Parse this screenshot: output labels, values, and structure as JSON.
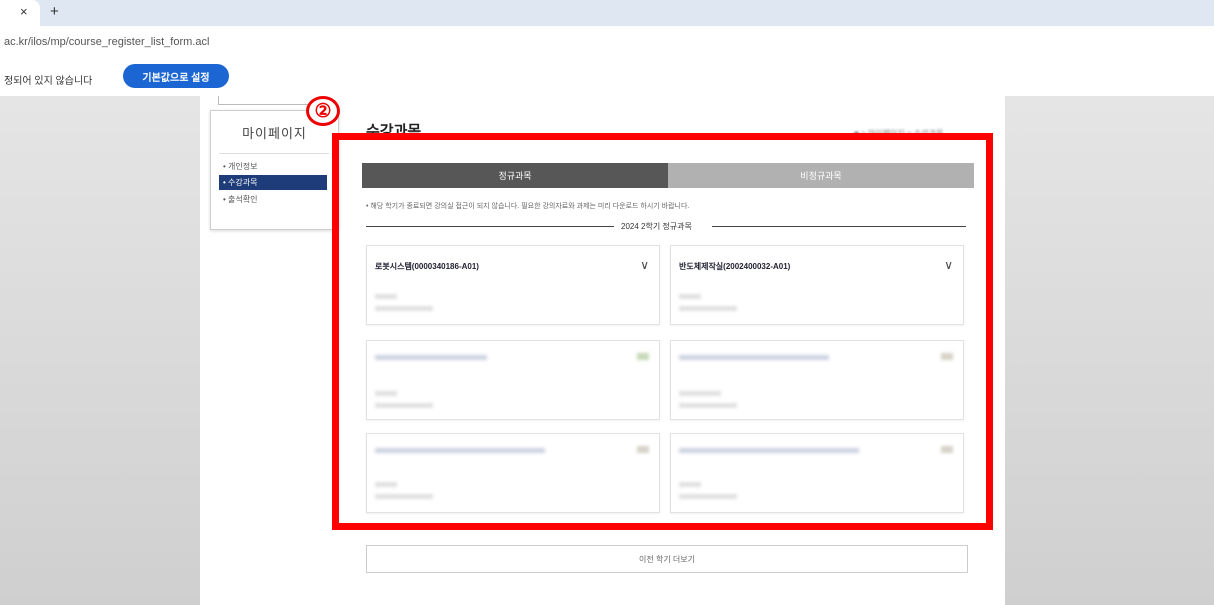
{
  "browser": {
    "tab_close": "×",
    "new_tab": "+",
    "url": "ac.kr/ilos/mp/course_register_list_form.acl",
    "infobar_text": "정되어 있지 않습니다",
    "default_button": "기본값으로 설정"
  },
  "sidebar": {
    "title": "마이페이지",
    "items": [
      {
        "label": "• 개인정보"
      },
      {
        "label": "• 수강과목"
      },
      {
        "label": "• 출석확인"
      }
    ]
  },
  "step_marker": "②",
  "page": {
    "heading": "수강과목",
    "breadcrumb": "■ > 마이페이지 > 수강과목"
  },
  "course_tabs": {
    "regular": "정규과목",
    "nonregular": "비정규과목"
  },
  "notice": "• 해당 학기가 종료되면 강의실 접근이 되지 않습니다. 필요한 강의자료와 과제는 미리 다운로드 하시기 바랍니다.",
  "term_label": "2024 2학기 정규과목",
  "courses": [
    {
      "title": "로봇시스템(0000340186-A01)",
      "toggle": "∨"
    },
    {
      "title": "반도체제작실(2002400032-A01)",
      "toggle": "∨"
    },
    {
      "title": "",
      "toggle": ""
    },
    {
      "title": "",
      "toggle": ""
    },
    {
      "title": "",
      "toggle": ""
    },
    {
      "title": "",
      "toggle": ""
    }
  ],
  "more_button": "이전 학기 더보기",
  "colors": {
    "highlight_red": "#ff0000",
    "active_tab": "#575757",
    "inactive_tab": "#b1b1b1",
    "sidebar_active": "#1f3c7a",
    "primary_button": "#1b66d2"
  }
}
